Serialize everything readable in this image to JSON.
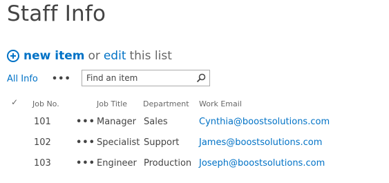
{
  "page": {
    "title": "Staff Info"
  },
  "commands": {
    "new_item": "new item",
    "or": "or",
    "edit": "edit",
    "this_list": "this list"
  },
  "views": {
    "current": "All Info",
    "more": "•••"
  },
  "search": {
    "placeholder": "Find an item"
  },
  "table": {
    "headers": {
      "check": "✓",
      "job_no": "Job No.",
      "job_title": "Job Title",
      "department": "Department",
      "work_email": "Work Email"
    },
    "rows": [
      {
        "job_no": "101",
        "menu": "•••",
        "job_title": "Manager",
        "department": "Sales",
        "work_email": "Cynthia@boostsolutions.com"
      },
      {
        "job_no": "102",
        "menu": "•••",
        "job_title": "Specialist",
        "department": "Support",
        "work_email": "James@boostsolutions.com"
      },
      {
        "job_no": "103",
        "menu": "•••",
        "job_title": "Engineer",
        "department": "Production",
        "work_email": "Joseph@boostsolutions.com"
      }
    ]
  },
  "colors": {
    "link": "#0072c6",
    "text": "#444444",
    "muted": "#666666"
  }
}
